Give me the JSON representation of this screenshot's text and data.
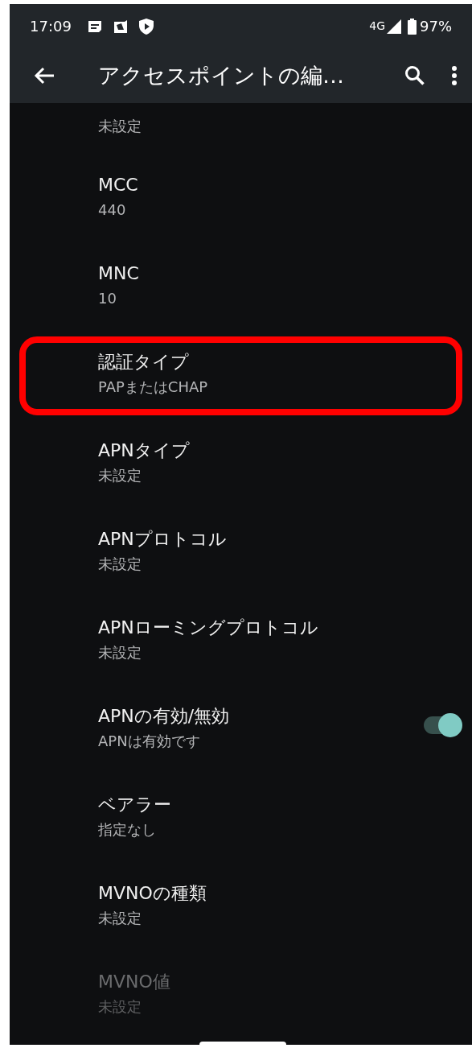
{
  "status_bar": {
    "time": "17:09",
    "network": "4G",
    "battery": "97%"
  },
  "app_bar": {
    "title": "アクセスポイントの編…"
  },
  "items": [
    {
      "kind": "partial",
      "value": "未設定",
      "highlighted": false,
      "disabled": false
    },
    {
      "kind": "text",
      "title": "MCC",
      "value": "440",
      "highlighted": false,
      "disabled": false
    },
    {
      "kind": "text",
      "title": "MNC",
      "value": "10",
      "highlighted": false,
      "disabled": false
    },
    {
      "kind": "text",
      "title": "認証タイプ",
      "value": "PAPまたはCHAP",
      "highlighted": true,
      "disabled": false
    },
    {
      "kind": "text",
      "title": "APNタイプ",
      "value": "未設定",
      "highlighted": false,
      "disabled": false
    },
    {
      "kind": "text",
      "title": "APNプロトコル",
      "value": "未設定",
      "highlighted": false,
      "disabled": false
    },
    {
      "kind": "text",
      "title": "APNローミングプロトコル",
      "value": "未設定",
      "highlighted": false,
      "disabled": false
    },
    {
      "kind": "switch",
      "title": "APNの有効/無効",
      "value": "APNは有効です",
      "on": true,
      "highlighted": false,
      "disabled": false
    },
    {
      "kind": "text",
      "title": "ベアラー",
      "value": "指定なし",
      "highlighted": false,
      "disabled": false
    },
    {
      "kind": "text",
      "title": "MVNOの種類",
      "value": "未設定",
      "highlighted": false,
      "disabled": false
    },
    {
      "kind": "text",
      "title": "MVNO値",
      "value": "未設定",
      "highlighted": false,
      "disabled": true
    }
  ]
}
